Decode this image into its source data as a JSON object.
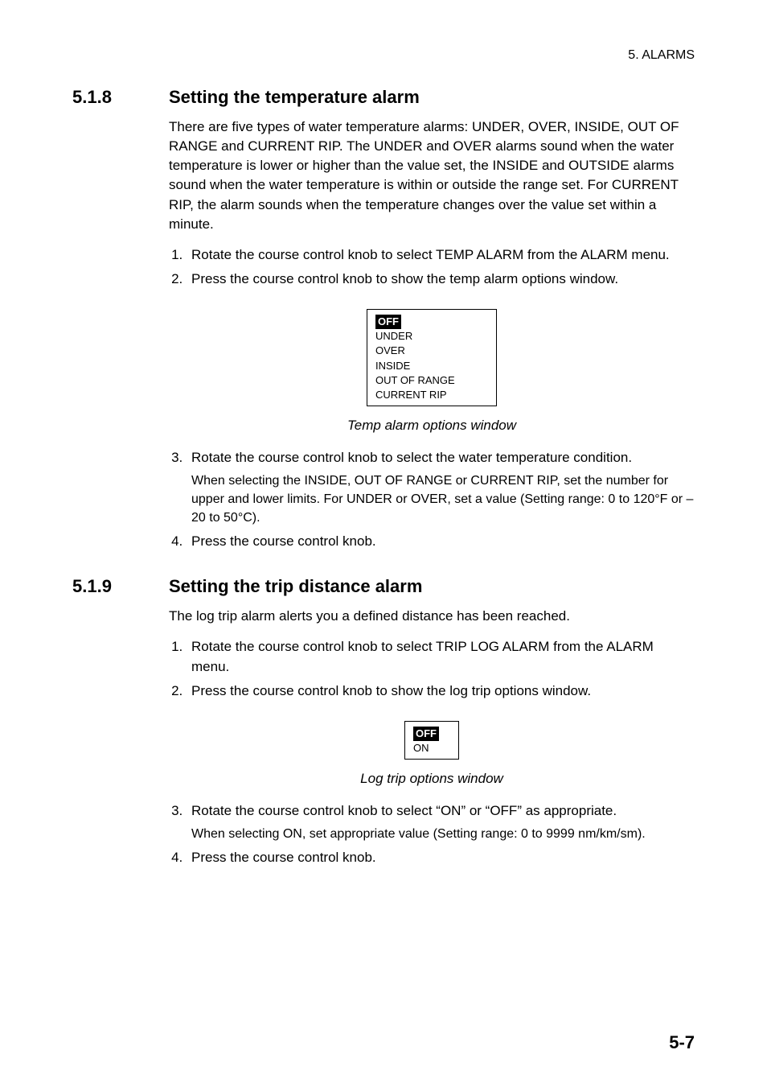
{
  "header": {
    "chapter": "5.  ALARMS"
  },
  "s518": {
    "num": "5.1.8",
    "title": "Setting the temperature alarm",
    "intro": "There are five types of water temperature alarms: UNDER, OVER, INSIDE, OUT OF RANGE and CURRENT RIP. The UNDER and OVER alarms sound when the water temperature is lower or higher than the value set, the INSIDE and OUTSIDE alarms sound when the water temperature is within or outside the range set. For CURRENT RIP, the alarm sounds when the temperature changes over the value set within a minute.",
    "step1": "Rotate the course control knob to select TEMP ALARM from the ALARM menu.",
    "step2": "Press the course control knob to show the temp alarm options window.",
    "options": {
      "o0": "OFF",
      "o1": "UNDER",
      "o2": "OVER",
      "o3": "INSIDE",
      "o4": "OUT OF RANGE",
      "o5": "CURRENT RIP"
    },
    "fig_caption": "Temp alarm options window",
    "step3": "Rotate the course control knob to select the water temperature condition.",
    "step3_note": "When selecting the INSIDE, OUT OF RANGE or CURRENT RIP, set the number for upper and lower limits. For UNDER or OVER, set a value (Setting range: 0 to 120°F or –20 to 50°C).",
    "step4": "Press the course control knob."
  },
  "s519": {
    "num": "5.1.9",
    "title": "Setting the trip distance alarm",
    "intro": "The log trip alarm alerts you a defined distance has been reached.",
    "step1": "Rotate the course control knob to select TRIP LOG ALARM from the ALARM menu.",
    "step2": "Press the course control knob to show the log trip options window.",
    "options": {
      "o0": "OFF",
      "o1": "ON"
    },
    "fig_caption": "Log trip options window",
    "step3": "Rotate the course control knob to select “ON” or “OFF” as appropriate.",
    "step3_note": "When selecting ON, set appropriate value (Setting range: 0 to 9999 nm/km/sm).",
    "step4": "Press the course control knob."
  },
  "footer": {
    "page_num": "5-7"
  }
}
